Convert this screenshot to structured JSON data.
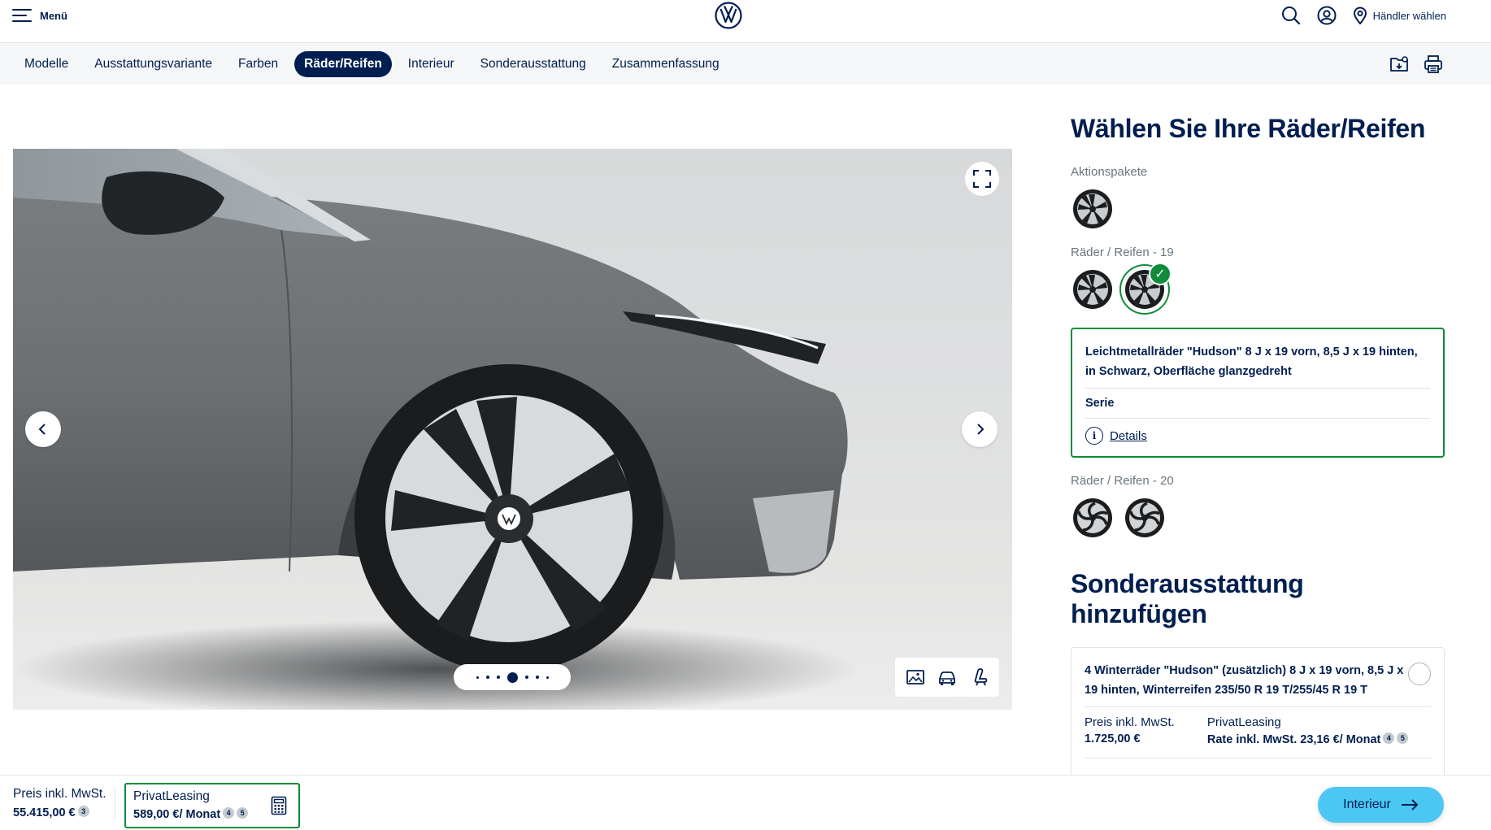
{
  "header": {
    "menu_label": "Menü",
    "dealer_label": "Händler wählen",
    "icons": [
      "menu-icon",
      "vw-logo",
      "search-icon",
      "user-icon",
      "location-pin-icon"
    ]
  },
  "nav": {
    "items": [
      "Modelle",
      "Ausstattungsvariante",
      "Farben",
      "Räder/Reifen",
      "Interieur",
      "Sonderausstattung",
      "Zusammenfassung"
    ],
    "active_index": 3,
    "right_icons": [
      "save-config-icon",
      "print-icon"
    ]
  },
  "gallery": {
    "slide_count": 7,
    "active_slide": 3,
    "view_icons": [
      "image-view-icon",
      "car-front-view-icon",
      "seat-view-icon"
    ]
  },
  "panel": {
    "title": "Wählen Sie Ihre Räder/Reifen",
    "groups": [
      {
        "label": "Aktionspakete",
        "count": 1
      },
      {
        "label": "Räder / Reifen - 19",
        "count": 2,
        "selected": 1
      },
      {
        "label": "Räder / Reifen - 20",
        "count": 2
      }
    ],
    "selected_detail": {
      "title": "Leichtmetallräder \"Hudson\" 8 J x 19 vorn, 8,5 J x 19 hinten, in Schwarz, Oberfläche glanzgedreht",
      "status": "Serie",
      "details_link": "Details"
    },
    "extras_title": "Sonderausstattung hinzufügen",
    "extra_item": {
      "title": "4 Winterräder \"Hudson\" (zusätzlich) 8 J x 19 vorn, 8,5 J x 19 hinten, Winterreifen 235/50 R 19 T/255/45 R 19 T",
      "price_label": "Preis inkl. MwSt.",
      "price_value": "1.725,00 €",
      "leasing_label": "PrivatLeasing",
      "leasing_value": "Rate inkl. MwSt. 23,16 €/ Monat",
      "footnotes": [
        "4",
        "5"
      ]
    }
  },
  "bottom": {
    "price_label": "Preis inkl. MwSt.",
    "price_value": "55.415,00 €",
    "price_footnote": "3",
    "leasing_label": "PrivatLeasing",
    "leasing_value": "589,00 €/ Monat",
    "leasing_footnotes": [
      "4",
      "5"
    ],
    "next_label": "Interieur"
  },
  "colors": {
    "brand_dark": "#001e50",
    "selected_green": "#0f8b3a",
    "cta_blue": "#4cc7f4"
  }
}
